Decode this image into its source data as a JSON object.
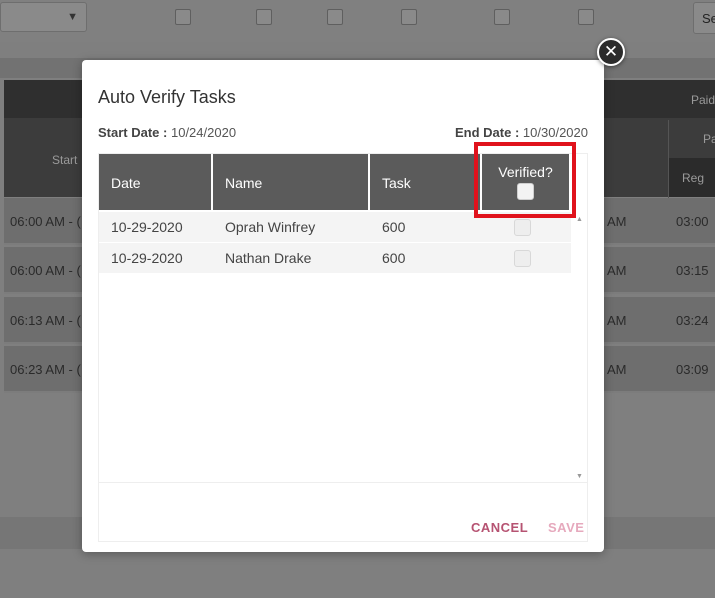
{
  "background": {
    "select_label": "Se",
    "table": {
      "header_top": "Paid",
      "header_left": "Start",
      "sub_header": "Pa",
      "sub_header2": "Reg",
      "rows": [
        {
          "start": "06:00 AM - (",
          "mid": "AM",
          "reg": "03:00"
        },
        {
          "start": "06:00 AM - (",
          "mid": "AM",
          "reg": "03:15"
        },
        {
          "start": "06:13 AM - (",
          "mid": "AM",
          "reg": "03:24"
        },
        {
          "start": "06:23 AM - (",
          "mid": "AM",
          "reg": "03:09"
        }
      ]
    }
  },
  "modal": {
    "title": "Auto Verify Tasks",
    "start_date_label": "Start Date :",
    "start_date_value": "10/24/2020",
    "end_date_label": "End Date :",
    "end_date_value": "10/30/2020",
    "columns": [
      "Date",
      "Name",
      "Task",
      "Verified?"
    ],
    "rows": [
      {
        "date": "10-29-2020",
        "name": "Oprah Winfrey",
        "task": "600",
        "verified": false
      },
      {
        "date": "10-29-2020",
        "name": "Nathan Drake",
        "task": "600",
        "verified": false
      }
    ],
    "buttons": {
      "cancel": "CANCEL",
      "save": "SAVE"
    },
    "highlight_color": "#e0121c"
  },
  "icons": {
    "close": "close-icon",
    "dropdown": "chevron-down-icon",
    "scroll_up": "scroll-up-arrow-icon",
    "scroll_down": "scroll-down-arrow-icon"
  }
}
